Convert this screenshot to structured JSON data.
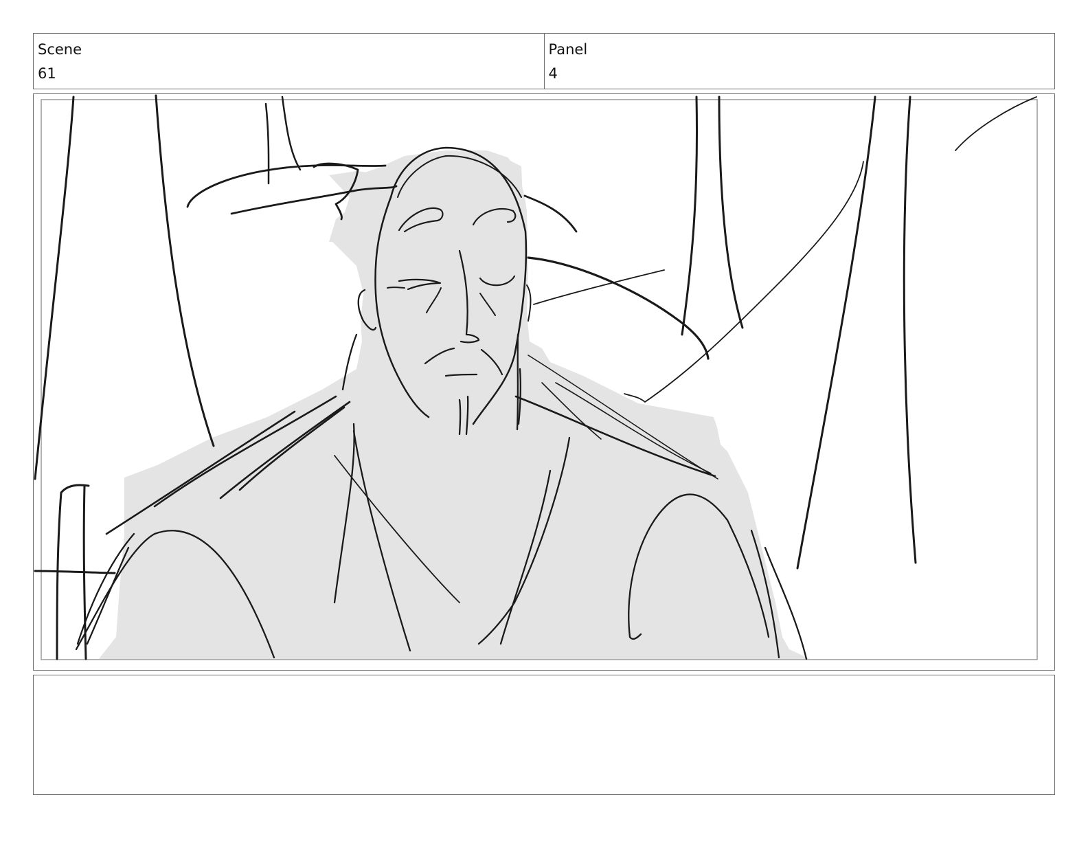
{
  "header": {
    "scene_label": "Scene",
    "scene_value": "61",
    "panel_label": "Panel",
    "panel_value": "4"
  },
  "frame": {
    "description_icon": "sketch-illustration"
  },
  "notes": {
    "text": ""
  }
}
